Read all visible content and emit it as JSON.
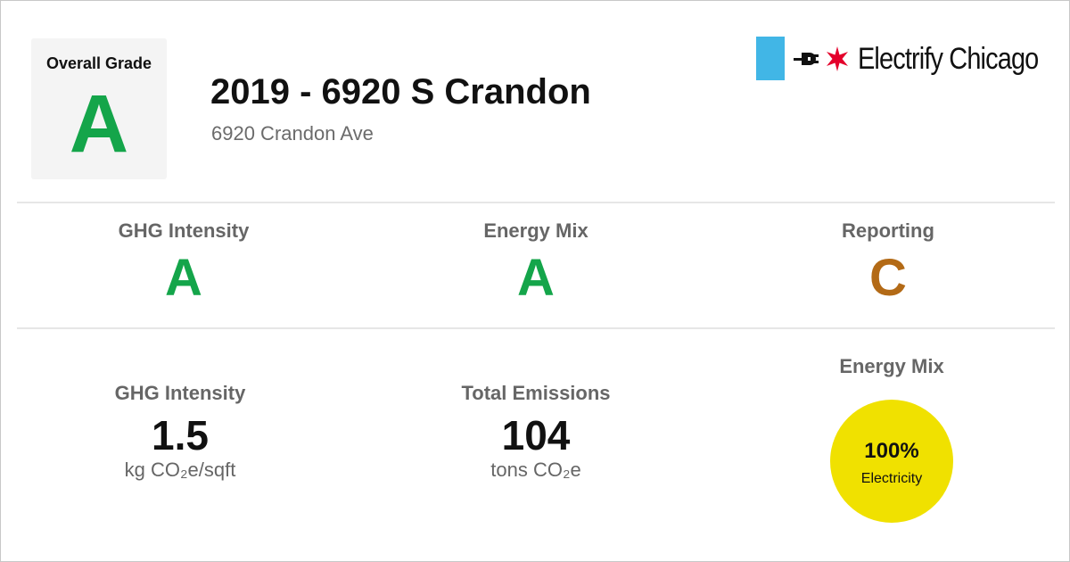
{
  "overall": {
    "label": "Overall Grade",
    "grade": "A"
  },
  "building": {
    "title": "2019 - 6920 S Crandon",
    "address": "6920 Crandon Ave"
  },
  "brand": {
    "name": "Electrify Chicago",
    "bar_color": "#41b6e6",
    "star_color": "#e4002b"
  },
  "grades": [
    {
      "label": "GHG Intensity",
      "grade": "A",
      "color": "#14a54a"
    },
    {
      "label": "Energy Mix",
      "grade": "A",
      "color": "#14a54a"
    },
    {
      "label": "Reporting",
      "grade": "C",
      "color": "#b36a16"
    }
  ],
  "metrics": {
    "ghg": {
      "label": "GHG Intensity",
      "value": "1.5",
      "unit": "kg CO₂e/sqft"
    },
    "emissions": {
      "label": "Total Emissions",
      "value": "104",
      "unit": "tons CO₂e"
    },
    "energy_mix": {
      "label": "Energy Mix",
      "percent": "100%",
      "source": "Electricity",
      "color": "#f0e100"
    }
  }
}
